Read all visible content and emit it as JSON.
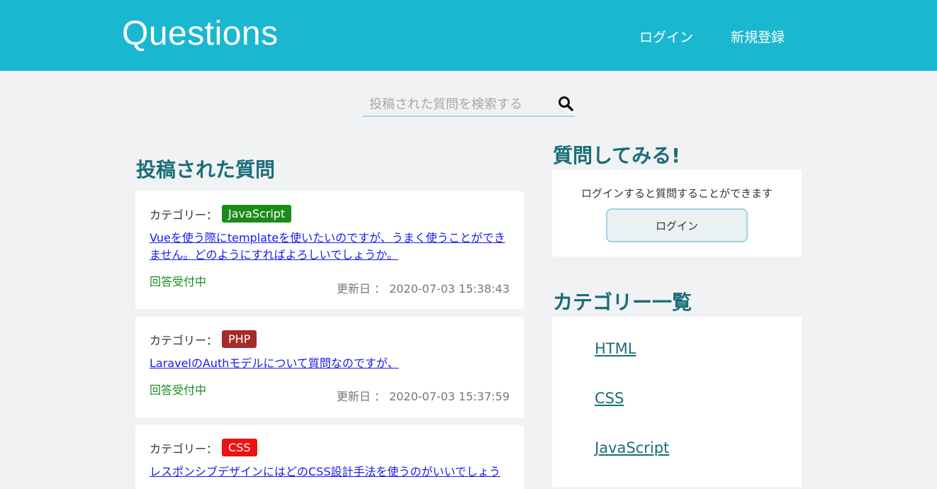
{
  "header": {
    "logo": "Questions",
    "nav_login": "ログイン",
    "nav_register": "新規登録"
  },
  "search": {
    "placeholder": "投稿された質問を検索する",
    "icon": "search-icon"
  },
  "questions_section": {
    "title": "投稿された質問"
  },
  "questions": [
    {
      "category_label": "カテゴリー：",
      "category": "JavaScript",
      "category_color": "#1b8a1b",
      "title": "Vueを使う際にtemplateを使いたいのですが、うまく使うことができません。どのようにすればよろしいでしょうか。",
      "status": "回答受付中",
      "updated": "更新日 ： 2020-07-03 15:38:43"
    },
    {
      "category_label": "カテゴリー：",
      "category": "PHP",
      "category_color": "#a52a2a",
      "title": "LaravelのAuthモデルについて質問なのですが、",
      "status": "回答受付中",
      "updated": "更新日 ： 2020-07-03 15:37:59"
    },
    {
      "category_label": "カテゴリー：",
      "category": "CSS",
      "category_color": "#ee1111",
      "title": "レスポンシブデザインにはどのCSS設計手法を使うのがいいでしょう"
    }
  ],
  "ask_section": {
    "title": "質問してみる!",
    "text": "ログインすると質問することができます",
    "button": "ログイン"
  },
  "categories_section": {
    "title": "カテゴリー一覧",
    "items": [
      "HTML",
      "CSS",
      "JavaScript"
    ]
  }
}
